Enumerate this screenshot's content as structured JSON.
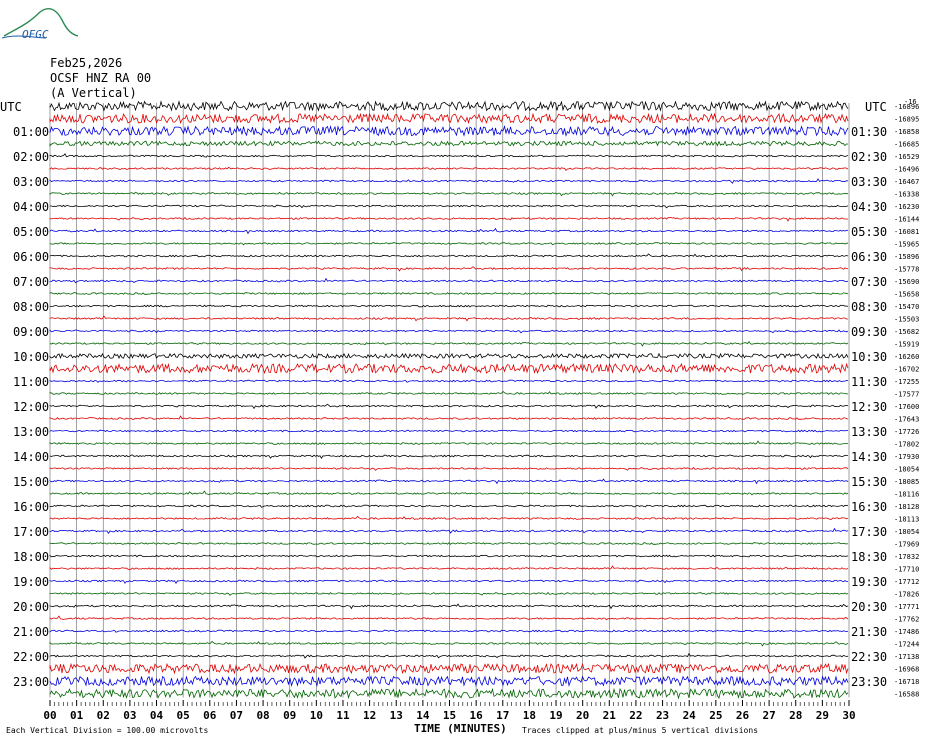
{
  "logo": {
    "text": "OFGC"
  },
  "header": {
    "date": "Feb25,2026",
    "station": "OCSF HNZ RA 00",
    "component": "(A Vertical)"
  },
  "utc_left": "UTC",
  "utc_right": "UTC",
  "top_right_value": "-16",
  "left_times": [
    "01:00",
    "02:00",
    "03:00",
    "04:00",
    "05:00",
    "06:00",
    "07:00",
    "08:00",
    "09:00",
    "10:00",
    "11:00",
    "12:00",
    "13:00",
    "14:00",
    "15:00",
    "16:00",
    "17:00",
    "18:00",
    "19:00",
    "20:00",
    "21:00",
    "22:00",
    "23:00"
  ],
  "right_times": [
    "01:30",
    "02:30",
    "03:30",
    "04:30",
    "05:30",
    "06:30",
    "07:30",
    "08:30",
    "09:30",
    "10:30",
    "11:30",
    "12:30",
    "13:30",
    "14:30",
    "15:30",
    "16:30",
    "17:30",
    "18:30",
    "19:30",
    "20:30",
    "21:30",
    "22:30",
    "23:30"
  ],
  "trace_colors": [
    "#000000",
    "#e00000",
    "#0000e0",
    "#006400"
  ],
  "chart_data": {
    "type": "line",
    "title": "",
    "xlabel": "TIME (MINUTES)",
    "ylabel": "",
    "xlim": [
      0,
      30
    ],
    "x_ticks": [
      "00",
      "01",
      "02",
      "03",
      "04",
      "05",
      "06",
      "07",
      "08",
      "09",
      "10",
      "11",
      "12",
      "13",
      "14",
      "15",
      "16",
      "17",
      "18",
      "19",
      "20",
      "21",
      "22",
      "23",
      "24",
      "25",
      "26",
      "27",
      "28",
      "29",
      "30"
    ],
    "trace_count": 48,
    "trace_offsets": [
      -16896,
      -16895,
      -16858,
      -16685,
      -16529,
      -16496,
      -16467,
      -16338,
      -16230,
      -16144,
      -16081,
      -15965,
      -15896,
      -15778,
      -15690,
      -15658,
      -15470,
      -15503,
      -15682,
      -15919,
      -16260,
      -16702,
      -17255,
      -17577,
      -17600,
      -17643,
      -17726,
      -17802,
      -17930,
      -18054,
      -18085,
      -18116,
      -18128,
      -18113,
      -18054,
      -17969,
      -17832,
      -17710,
      -17712,
      -17826,
      -17771,
      -17762,
      -17486,
      -17244,
      -17138,
      -16968,
      -16718,
      -16588
    ],
    "activity": [
      3,
      3,
      3,
      2,
      1,
      1,
      1,
      1,
      1,
      1,
      1,
      1,
      1,
      1,
      1,
      1,
      1,
      1,
      1,
      1,
      2,
      3,
      1,
      1,
      1,
      1,
      1,
      1,
      1,
      1,
      1,
      1,
      1,
      1,
      1,
      1,
      1,
      1,
      1,
      1,
      1,
      1,
      1,
      1,
      1,
      3,
      3,
      3
    ],
    "footer_left": "Each Vertical Division =  100.00 microvolts",
    "footer_right": "Traces clipped at plus/minus 5 vertical divisions"
  }
}
